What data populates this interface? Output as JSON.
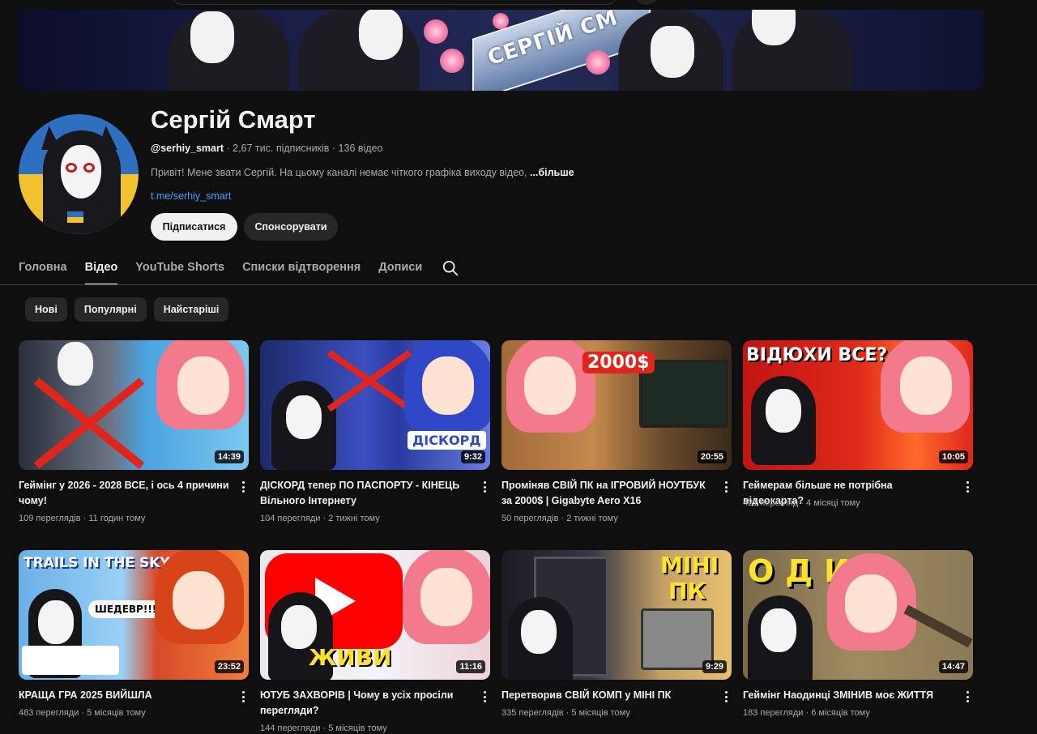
{
  "channel": {
    "banner_text": "СЕРГІЙ СМ",
    "name": "Сергій Смарт",
    "handle": "@serhiy_smart",
    "stats": " · 2,67 тис. підписників · 136 відео",
    "description": "Привіт! Мене звати Сергій. На цьому каналі немає чіткого графіка виходу відео, ",
    "more_label": "...більше",
    "link": "t.me/serhiy_smart",
    "subscribe_label": "Підписатися",
    "sponsor_label": "Спонсорувати"
  },
  "tabs": [
    {
      "label": "Головна"
    },
    {
      "label": "Відео"
    },
    {
      "label": "YouTube Shorts"
    },
    {
      "label": "Списки відтворення"
    },
    {
      "label": "Дописи"
    }
  ],
  "chips": [
    {
      "label": "Нові"
    },
    {
      "label": "Популярні"
    },
    {
      "label": "Найстаріші"
    }
  ],
  "videos": [
    {
      "title": "Геймінг у 2026 - 2028 ВСЕ, і ось 4 причини чому!",
      "meta": "109 переглядів · 11 годин тому",
      "duration": "14:39"
    },
    {
      "title": "ДІСКОРД тепер ПО ПАСПОРТУ - КІНЕЦЬ Вільного Інтернету",
      "meta": "104 перегляди · 2 тижні тому",
      "duration": "9:32",
      "thumb_text": "ДІСКОРД"
    },
    {
      "title": "Проміняв СВІЙ ПК на ІГРОВИЙ НОУТБУК за 2000$ | Gigabyte Aero X16",
      "meta": "50 переглядів · 2 тижні тому",
      "duration": "20:55",
      "thumb_text": "2000$"
    },
    {
      "title": "Геймерам більше не потрібна відеокарта?",
      "meta": "421 перегляд · 4 місяці тому",
      "duration": "10:05",
      "thumb_text": "ВІДЮХИ ВСЕ?"
    },
    {
      "title": "КРАЩА ГРА 2025 ВИЙШЛА",
      "meta": "483 перегляди · 5 місяців тому",
      "duration": "23:52",
      "thumb_text": "TRAILS IN THE SKY 1st",
      "thumb_text2": "ШЕДЕВР!!!"
    },
    {
      "title": "ЮТУБ ЗАХВОРІВ | Чому в усіх просіли перегляди?",
      "meta": "144 перегляди · 5 місяців тому",
      "duration": "11:16",
      "thumb_text": "ЖИВИ"
    },
    {
      "title": "Перетворив СВІЙ КОМП у МІНІ ПК",
      "meta": "335 переглядів · 5 місяців тому",
      "duration": "9:29",
      "thumb_text": "МІНІ",
      "thumb_text2": "ПК"
    },
    {
      "title": "Геймінг Наодинці ЗМІНИВ моє ЖИТТЯ",
      "meta": "183 перегляди · 6 місяців тому",
      "duration": "14:47",
      "thumb_text": "ОДИН"
    }
  ],
  "colors": {
    "background": "#0f0f0f",
    "link": "#3ea6ff",
    "chip": "#272727"
  }
}
